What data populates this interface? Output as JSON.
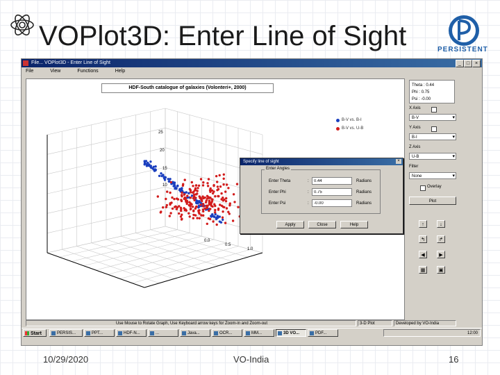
{
  "slide": {
    "title": "VOPlot3D: Enter Line of Sight",
    "logo_text": "PERSISTENT",
    "footer_date": "10/29/2020",
    "footer_center": "VO-India",
    "footer_page": "16"
  },
  "window": {
    "title": "File... VOPlot3D - Enter Line of Sight",
    "menu": [
      "File",
      "View",
      "Functions",
      "Help"
    ]
  },
  "plot": {
    "title": "HDF-South catalogue of galaxies (Volonteri+, 2000)",
    "legend": [
      {
        "label": "B-V vs. B-I",
        "color": "#1a3fbf"
      },
      {
        "label": "B-V vs. U-B",
        "color": "#d21c1c"
      }
    ],
    "axis_ticks": [
      "25",
      "20",
      "15",
      "10",
      "0.0",
      "0.5",
      "1.0"
    ]
  },
  "side_panel": {
    "angles": {
      "theta_label": "Theta",
      "theta": "0.44",
      "phi_label": "Phi",
      "phi": "0.75",
      "psi_label": "Psi",
      "psi": "-0.00"
    },
    "x_axis_label": "X Axis",
    "x_axis_value": "B-V",
    "y_axis_label": "Y Axis",
    "y_axis_value": "B-I",
    "z_axis_label": "Z Axis",
    "z_axis_value": "U-B",
    "filter_label": "Filter",
    "filter_value": "None",
    "overlay_label": "Overlay",
    "plot_button": "Plot"
  },
  "dialog": {
    "title": "Specify line of sight",
    "group_label": "Enter Angles",
    "rows": [
      {
        "label": "Enter Theta",
        "value": "0.44",
        "unit": "Radians"
      },
      {
        "label": "Enter Phi",
        "value": "0.75",
        "unit": "Radians"
      },
      {
        "label": "Enter Psi",
        "value": "-0.00",
        "unit": "Radians"
      }
    ],
    "buttons": {
      "apply": "Apply",
      "close": "Close",
      "help": "Help"
    }
  },
  "statusbar": {
    "message": "Use Mouse to Rotate Graph, Use Keyboard arrow keys for Zoom-in and Zoom-out",
    "segment2": "3-D Plot",
    "segment3": "Developed by VO-India"
  },
  "taskbar": {
    "start": "Start",
    "items": [
      "PERSIS...",
      "PPT...",
      "HDF-N...",
      "...",
      "Java...",
      "OCR...",
      "MM...",
      "3D VO...",
      "PDF..."
    ],
    "active_index": 7,
    "tray_time": "12:00"
  },
  "data_points": {
    "blue_series_count": 120,
    "red_series_count": 220
  }
}
